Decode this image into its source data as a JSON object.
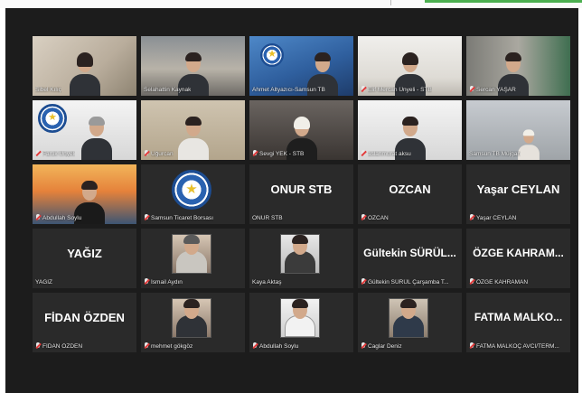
{
  "participants": [
    {
      "name": "Sibel Kılıç",
      "muted": false,
      "display": "",
      "active": true
    },
    {
      "name": "Selahattin Kaynak",
      "muted": false,
      "display": ""
    },
    {
      "name": "Ahmet Altyazıcı-Samsun TB",
      "muted": false,
      "display": ""
    },
    {
      "name": "Elif Mercan Ünyeli - STB",
      "muted": true,
      "display": ""
    },
    {
      "name": "Sercan YAŞAR",
      "muted": true,
      "display": ""
    },
    {
      "name": "Faruk Ünyeli",
      "muted": true,
      "display": ""
    },
    {
      "name": "Uğurcan",
      "muted": true,
      "display": ""
    },
    {
      "name": "Sevgi YEK - STB",
      "muted": true,
      "display": ""
    },
    {
      "name": "aslanmurat aksu",
      "muted": true,
      "display": ""
    },
    {
      "name": "Samsun TB Müjgan",
      "muted": false,
      "display": ""
    },
    {
      "name": "Abdullah Soylu",
      "muted": true,
      "display": ""
    },
    {
      "name": "Samsun Ticaret Borsası",
      "muted": true,
      "display": ""
    },
    {
      "name": "ONUR STB",
      "muted": false,
      "display": "ONUR STB"
    },
    {
      "name": "OZCAN",
      "muted": true,
      "display": "OZCAN"
    },
    {
      "name": "Yaşar CEYLAN",
      "muted": true,
      "display": "Yaşar CEYLAN"
    },
    {
      "name": "YAĞIZ",
      "muted": false,
      "display": "YAĞIZ"
    },
    {
      "name": "İsmail Aydın",
      "muted": true,
      "display": ""
    },
    {
      "name": "Kaya Aktaş",
      "muted": false,
      "display": ""
    },
    {
      "name": "Gültekin SÜRÜL Çarşamba T...",
      "muted": true,
      "display": "Gültekin SÜRÜL..."
    },
    {
      "name": "ÖZGE KAHRAMAN",
      "muted": true,
      "display": "ÖZGE KAHRAM..."
    },
    {
      "name": "FİDAN ÖZDEN",
      "muted": true,
      "display": "FİDAN ÖZDEN"
    },
    {
      "name": "mehmet gökgöz",
      "muted": true,
      "display": ""
    },
    {
      "name": "Abdullah Soylu",
      "muted": true,
      "display": ""
    },
    {
      "name": "Caglar Deniz",
      "muted": true,
      "display": ""
    },
    {
      "name": "FATMA MALKOÇ AVCI/TERM...",
      "muted": true,
      "display": "FATMA MALKO..."
    }
  ],
  "colors": {
    "active_border": "#c6e01a",
    "muted_mic": "#e23b3b",
    "tile_bg": "#2a2a2a",
    "screen_bg": "#1c1c1c"
  }
}
